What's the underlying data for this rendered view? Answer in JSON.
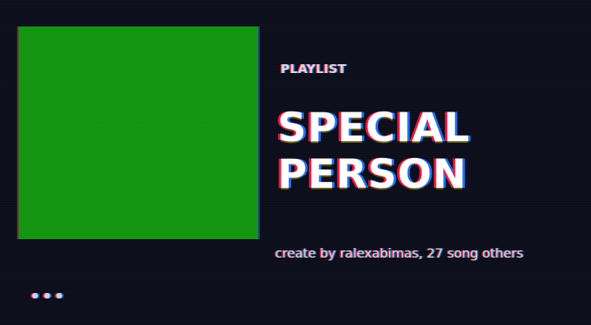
{
  "playlist": {
    "type_label": "PLAYLIST",
    "title_line1": "SPECIAL",
    "title_line2": "PERSON",
    "meta": "create by ralexabimas, 27 song others",
    "cover_color": "#119410"
  },
  "controls": {
    "more_icon": "more-horizontal-icon"
  },
  "colors": {
    "background": "#0b0d1a",
    "glitch_red": "#ff1c3c",
    "glitch_blue": "#1e78ff"
  }
}
